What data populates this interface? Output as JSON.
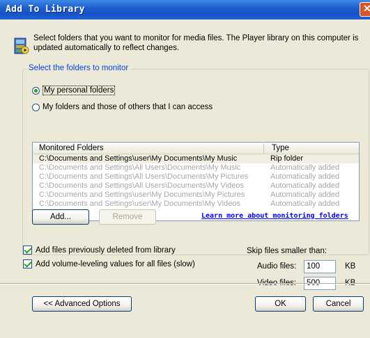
{
  "window": {
    "title": "Add To Library",
    "close_glyph": "✕"
  },
  "intro": {
    "icon": "media-library-icon",
    "text": "Select folders that you want to monitor for media files. The Player library on this computer is updated automatically to reflect changes."
  },
  "group": {
    "legend": "Select the folders to monitor",
    "radio_personal": "My personal folders",
    "radio_all": "My folders and those of others that I can access",
    "selected_radio": "personal"
  },
  "folders": {
    "headers": {
      "folder": "Monitored Folders",
      "type": "Type"
    },
    "rows": [
      {
        "folder": "C:\\Documents and Settings\\user\\My Documents\\My Music",
        "type": "Rip folder"
      },
      {
        "folder": "C:\\Documents and Settings\\All Users\\Documents\\My Music",
        "type": "Automatically added"
      },
      {
        "folder": "C:\\Documents and Settings\\All Users\\Documents\\My Pictures",
        "type": "Automatically added"
      },
      {
        "folder": "C:\\Documents and Settings\\All Users\\Documents\\My Videos",
        "type": "Automatically added"
      },
      {
        "folder": "C:\\Documents and Settings\\user\\My Documents\\My Pictures",
        "type": "Automatically added"
      },
      {
        "folder": "C:\\Documents and Settings\\user\\My Documents\\My Videos",
        "type": "Automatically added"
      }
    ]
  },
  "buttons": {
    "add": "Add...",
    "remove": "Remove",
    "advanced": "<< Advanced Options",
    "ok": "OK",
    "cancel": "Cancel"
  },
  "learn_more_link": "Learn more about monitoring folders",
  "options": {
    "add_deleted": "Add files previously deleted from library",
    "add_leveling": "Add volume-leveling values for all files (slow)"
  },
  "skip": {
    "title": "Skip files smaller than:",
    "audio_label": "Audio files:",
    "audio_value": "100",
    "video_label": "Video files:",
    "video_value": "500",
    "unit": "KB"
  }
}
